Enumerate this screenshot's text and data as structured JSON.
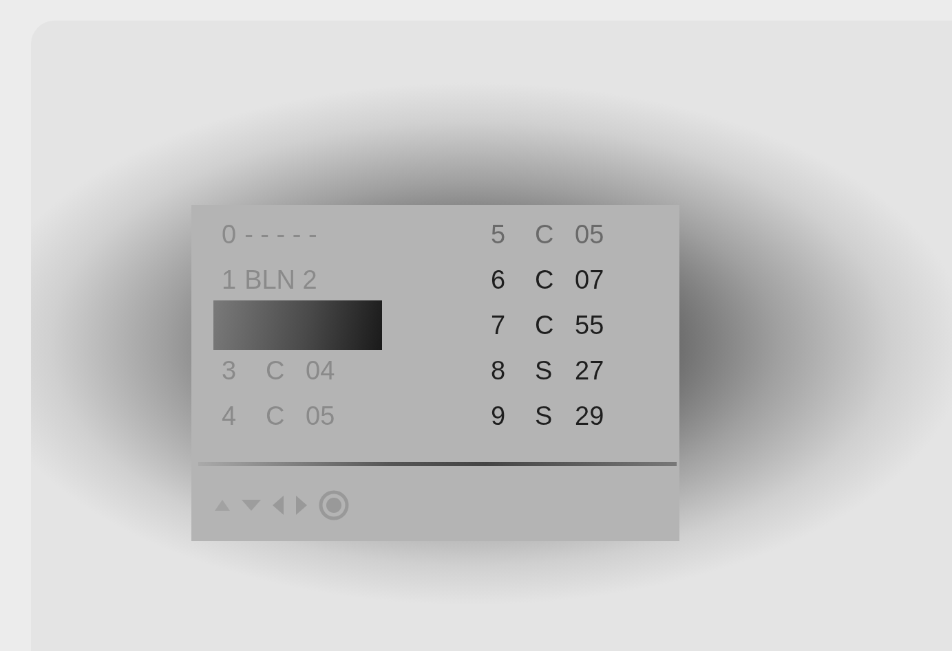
{
  "channel_list": {
    "slots": [
      {
        "kind": "name",
        "number": "0",
        "name": "- - - - -",
        "selected": false
      },
      {
        "kind": "name",
        "number": "1",
        "name": "BLN 2",
        "selected": false
      },
      {
        "kind": "empty",
        "selected": true
      },
      {
        "kind": "band",
        "number": "3",
        "band": "C",
        "channel": "04",
        "selected": false
      },
      {
        "kind": "band",
        "number": "4",
        "band": "C",
        "channel": "05",
        "selected": false
      },
      {
        "kind": "band",
        "number": "5",
        "band": "C",
        "channel": "05",
        "selected": false
      },
      {
        "kind": "band",
        "number": "6",
        "band": "C",
        "channel": "07",
        "selected": false
      },
      {
        "kind": "band",
        "number": "7",
        "band": "C",
        "channel": "55",
        "selected": false
      },
      {
        "kind": "band",
        "number": "8",
        "band": "S",
        "channel": "27",
        "selected": false
      },
      {
        "kind": "band",
        "number": "9",
        "band": "S",
        "channel": "29",
        "selected": false
      }
    ]
  }
}
